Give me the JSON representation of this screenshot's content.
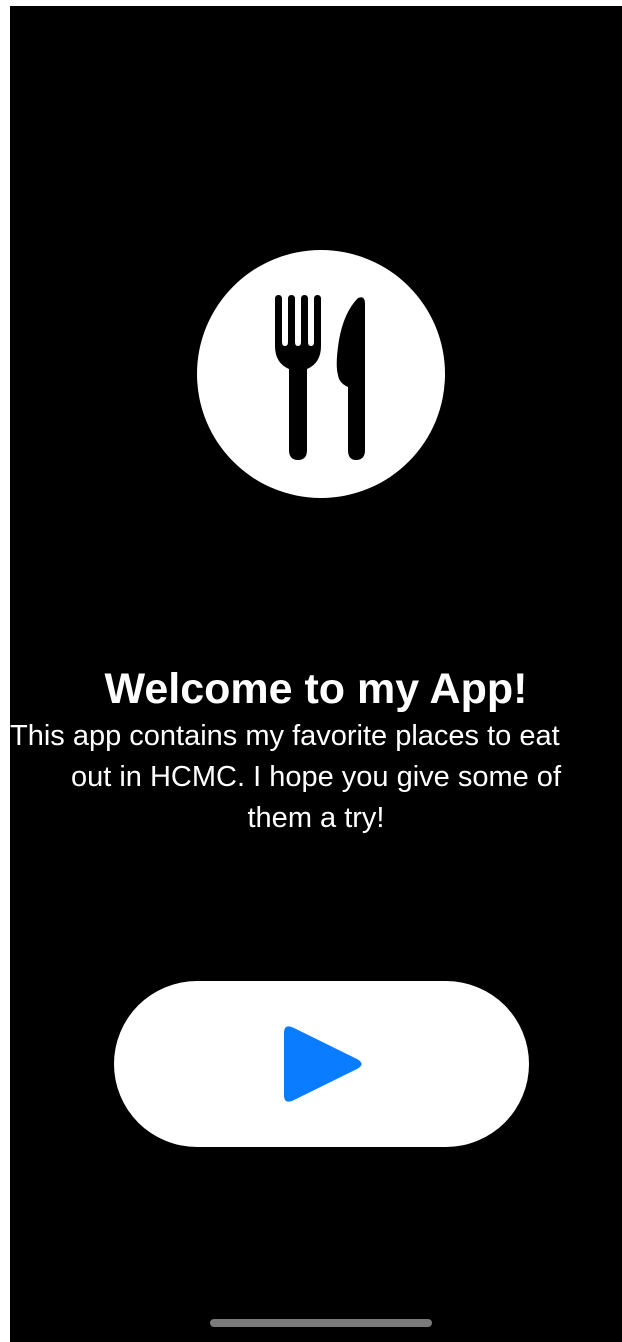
{
  "welcome": {
    "title": "Welcome to my App!",
    "description_lines": [
      "This app contains my favorite places to eat",
      "out in HCMC. I hope you give some of",
      "them a try!"
    ]
  },
  "icons": {
    "logo": "fork-knife-icon",
    "play": "play-icon",
    "play_color": "#0a7cff"
  },
  "colors": {
    "background": "#000000",
    "foreground": "#ffffff",
    "accent": "#0a7cff"
  }
}
